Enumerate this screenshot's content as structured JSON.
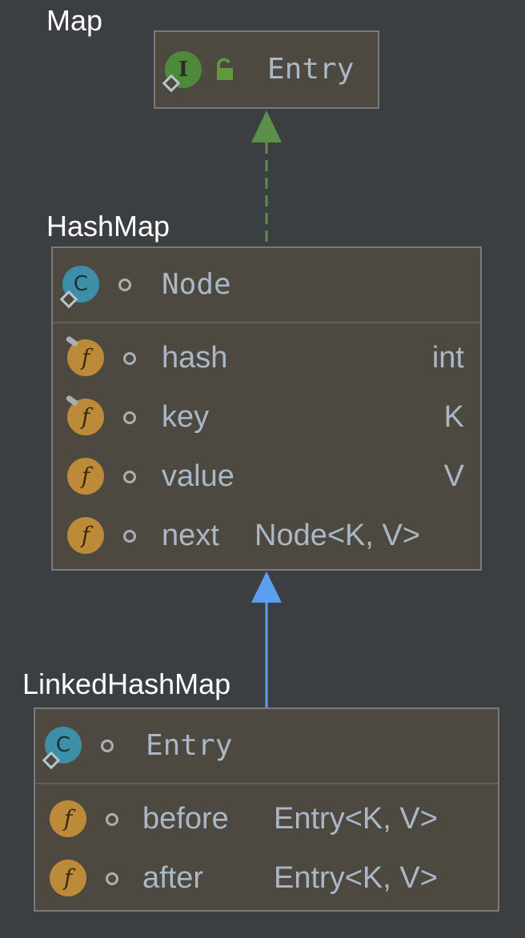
{
  "diagram": {
    "packages": {
      "map": "Map",
      "hashmap": "HashMap",
      "linkedhashmap": "LinkedHashMap"
    },
    "map_entry": {
      "icon_letter": "I",
      "name": "Entry"
    },
    "node": {
      "icon_letter": "C",
      "name": "Node",
      "fields": [
        {
          "icon_letter": "f",
          "name": "hash",
          "type": "int"
        },
        {
          "icon_letter": "f",
          "name": "key",
          "type": "K"
        },
        {
          "icon_letter": "f",
          "name": "value",
          "type": "V"
        },
        {
          "icon_letter": "f",
          "name": "next",
          "type": "Node<K, V>"
        }
      ]
    },
    "lhm_entry": {
      "icon_letter": "C",
      "name": "Entry",
      "fields": [
        {
          "icon_letter": "f",
          "name": "before",
          "type": "Entry<K, V>"
        },
        {
          "icon_letter": "f",
          "name": "after",
          "type": "Entry<K, V>"
        }
      ]
    },
    "colors": {
      "background": "#3c3f41",
      "box_fill": "#4d4941",
      "implements_arrow": "#5c8f4a",
      "extends_arrow": "#5c9ef0"
    }
  }
}
